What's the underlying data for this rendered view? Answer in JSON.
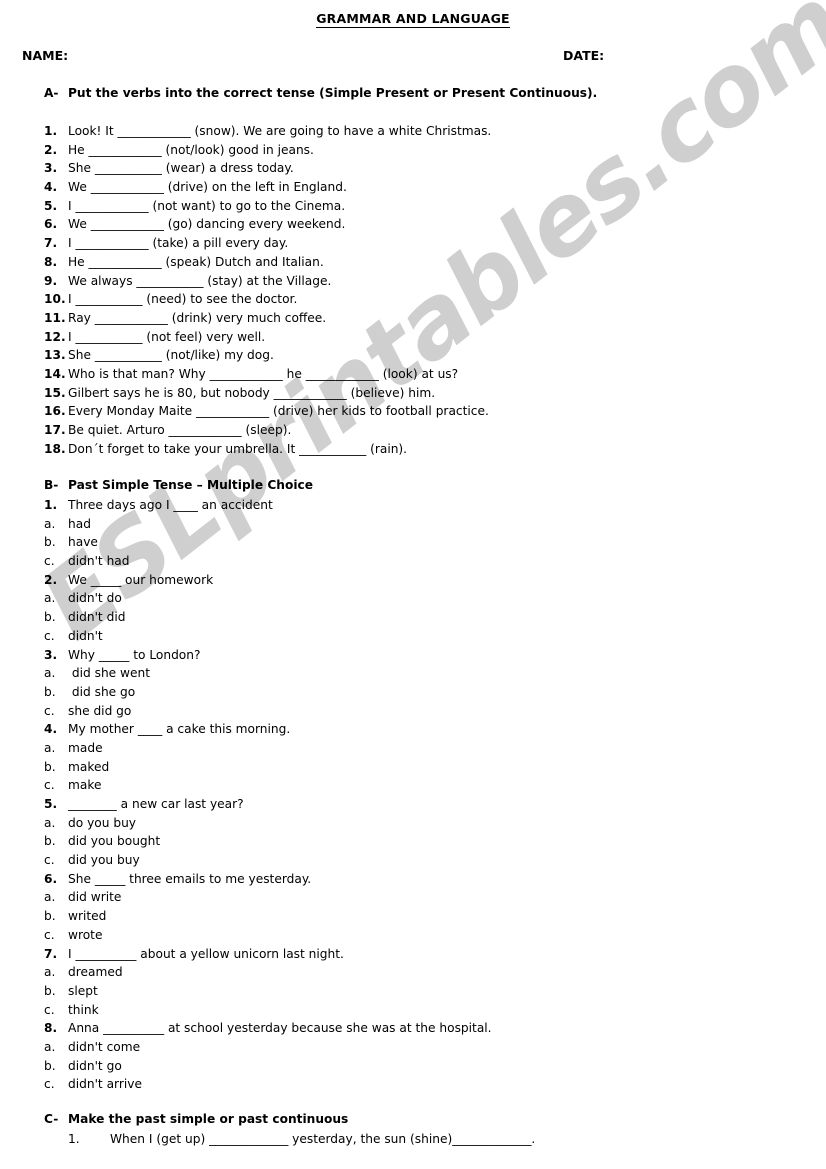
{
  "watermark": {
    "text": "ESLprintables.com",
    "color": "#cfcfcf"
  },
  "header": {
    "title": "GRAMMAR AND LANGUAGE",
    "name_label": "NAME:",
    "date_label": "DATE:"
  },
  "sections": {
    "a": {
      "letter": "A-",
      "heading": "Put the verbs into the correct tense (Simple Present or Present Continuous).",
      "items": [
        {
          "n": "1.",
          "text": "Look! It ____________ (snow). We are going to have a white Christmas."
        },
        {
          "n": "2.",
          "text": "He ____________ (not/look) good in jeans."
        },
        {
          "n": "3.",
          "text": "She ___________ (wear) a dress today."
        },
        {
          "n": "4.",
          "text": "We ____________ (drive) on the left in England."
        },
        {
          "n": "5.",
          "text": "I ____________ (not want) to go to the Cinema."
        },
        {
          "n": "6.",
          "text": "We ____________ (go) dancing every weekend."
        },
        {
          "n": "7.",
          "text": "I ____________ (take) a pill every day."
        },
        {
          "n": "8.",
          "text": "He ____________ (speak) Dutch and Italian."
        },
        {
          "n": "9.",
          "text": "We always ___________ (stay) at the Village."
        },
        {
          "n": "10.",
          "text": "I ___________ (need) to see the doctor."
        },
        {
          "n": "11.",
          "text": "Ray ____________ (drink) very much coffee."
        },
        {
          "n": "12.",
          "text": "I ___________ (not feel) very well."
        },
        {
          "n": "13.",
          "text": "She ___________ (not/like) my dog."
        },
        {
          "n": "14.",
          "text": "Who is that man? Why ____________ he ____________ (look) at us?"
        },
        {
          "n": "15.",
          "text": "Gilbert says he is 80, but nobody ____________ (believe) him."
        },
        {
          "n": "16.",
          "text": "Every Monday Maite ____________ (drive) her kids to football practice."
        },
        {
          "n": "17.",
          "text": "Be quiet. Arturo ____________ (sleep)."
        },
        {
          "n": "18.",
          "text": "Don´t forget to take your umbrella. It ___________ (rain)."
        }
      ]
    },
    "b": {
      "letter": "B-",
      "heading": "Past Simple Tense – Multiple Choice",
      "items": [
        {
          "n": "1.",
          "text": "Three days ago I ____ an accident",
          "bold": true
        },
        {
          "n": "a.",
          "text": "had",
          "bold": false
        },
        {
          "n": "b.",
          "text": "have",
          "bold": false
        },
        {
          "n": "c.",
          "text": "didn't had",
          "bold": false
        },
        {
          "n": "2.",
          "text": "We _____ our homework",
          "bold": true
        },
        {
          "n": "a.",
          "text": "didn't do",
          "bold": false
        },
        {
          "n": "b.",
          "text": "didn't did",
          "bold": false
        },
        {
          "n": "c.",
          "text": "didn't",
          "bold": false
        },
        {
          "n": "3.",
          "text": "Why _____ to London?",
          "bold": true
        },
        {
          "n": "a.",
          "text": " did she went",
          "bold": false
        },
        {
          "n": "b.",
          "text": " did she go",
          "bold": false
        },
        {
          "n": "c.",
          "text": "she did go",
          "bold": false
        },
        {
          "n": "4.",
          "text": "My mother ____ a cake this morning.",
          "bold": true
        },
        {
          "n": "a.",
          "text": "made",
          "bold": false
        },
        {
          "n": "b.",
          "text": "maked",
          "bold": false
        },
        {
          "n": "c.",
          "text": "make",
          "bold": false
        },
        {
          "n": "5.",
          "text": "________ a new car last year?",
          "bold": true
        },
        {
          "n": "a.",
          "text": "do you buy",
          "bold": false
        },
        {
          "n": "b.",
          "text": "did you bought",
          "bold": false
        },
        {
          "n": "c.",
          "text": "did you buy",
          "bold": false
        },
        {
          "n": "6.",
          "text": "She _____ three emails to me yesterday.",
          "bold": true
        },
        {
          "n": "a.",
          "text": "did write",
          "bold": false
        },
        {
          "n": "b.",
          "text": "writed",
          "bold": false
        },
        {
          "n": "c.",
          "text": "wrote",
          "bold": false
        },
        {
          "n": "7.",
          "text": "I __________ about a yellow unicorn last night.",
          "bold": true
        },
        {
          "n": "a.",
          "text": "dreamed",
          "bold": false
        },
        {
          "n": "b.",
          "text": "slept",
          "bold": false
        },
        {
          "n": "c.",
          "text": "think",
          "bold": false
        },
        {
          "n": "8.",
          "text": "Anna __________ at school yesterday because she was at the hospital.",
          "bold": true
        },
        {
          "n": "a.",
          "text": "didn't come",
          "bold": false
        },
        {
          "n": "b.",
          "text": "didn't go",
          "bold": false
        },
        {
          "n": "c.",
          "text": "didn't arrive",
          "bold": false
        }
      ]
    },
    "c": {
      "letter": "C-",
      "heading": "Make the past simple or past continuous",
      "items": [
        {
          "n": "1.",
          "text": "When I (get up) _____________ yesterday, the sun (shine)_____________."
        }
      ]
    }
  }
}
